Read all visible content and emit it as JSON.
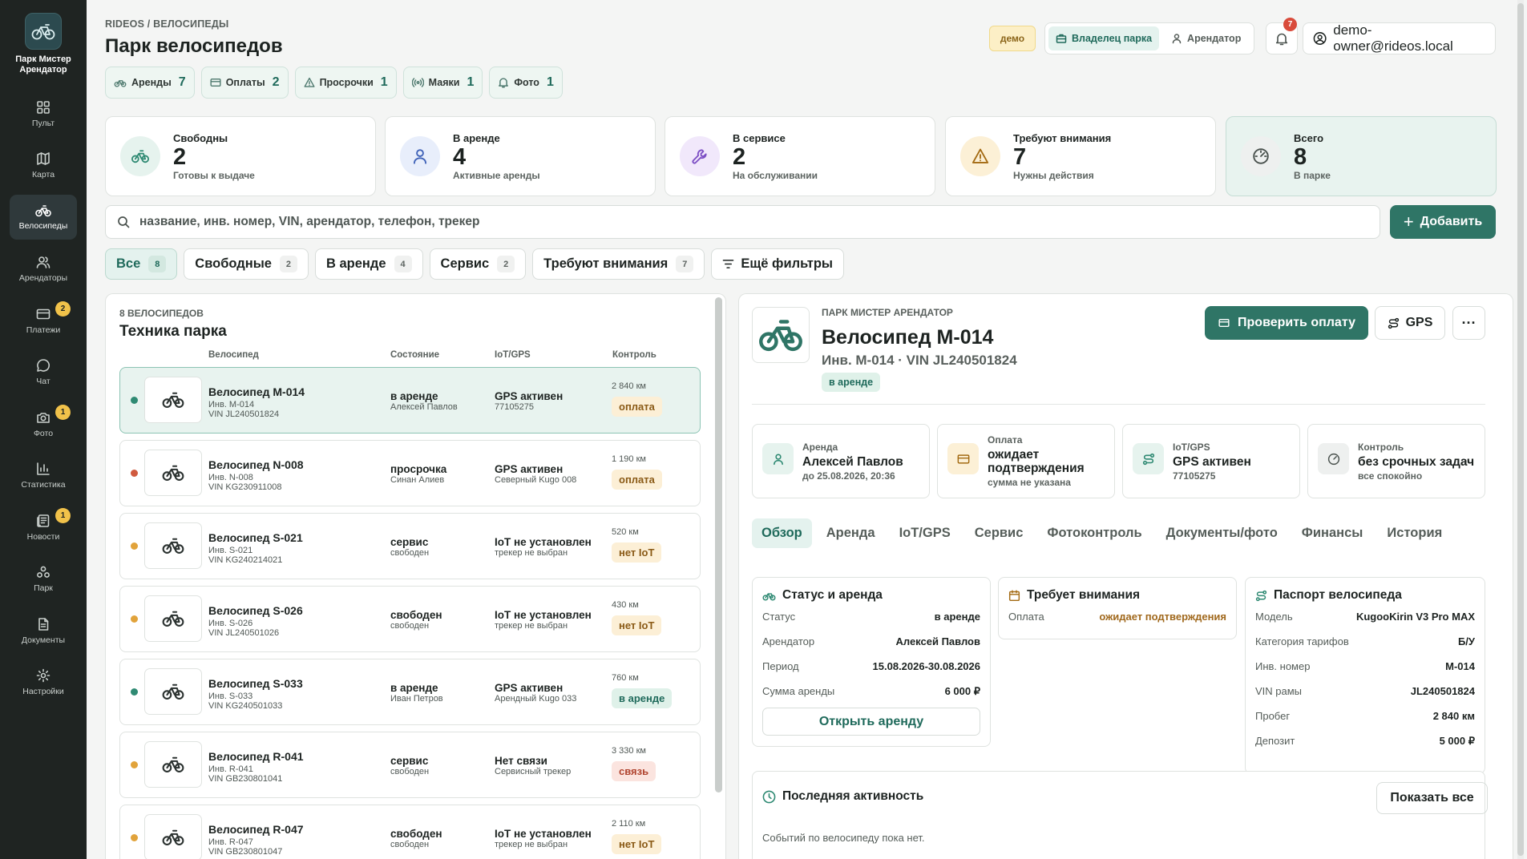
{
  "sidebar": {
    "brand": "Парк Мистер Арендатор",
    "items": [
      {
        "label": "Пульт",
        "icon": "dashboard-icon"
      },
      {
        "label": "Карта",
        "icon": "map-icon"
      },
      {
        "label": "Велосипеды",
        "icon": "bike-icon",
        "active": true
      },
      {
        "label": "Арендаторы",
        "icon": "users-icon"
      },
      {
        "label": "Платежи",
        "icon": "card-icon",
        "badge": "2"
      },
      {
        "label": "Чат",
        "icon": "chat-icon"
      },
      {
        "label": "Фото",
        "icon": "camera-icon",
        "badge": "1"
      },
      {
        "label": "Статистика",
        "icon": "stats-icon"
      },
      {
        "label": "Новости",
        "icon": "news-icon",
        "badge": "1"
      },
      {
        "label": "Парк",
        "icon": "park-icon"
      },
      {
        "label": "Документы",
        "icon": "document-icon"
      },
      {
        "label": "Настройки",
        "icon": "gear-icon"
      }
    ]
  },
  "header": {
    "breadcrumb": "RIDEOS / ВЕЛОСИПЕДЫ",
    "title": "Парк велосипедов",
    "demo": "демо",
    "role_owner": "Владелец парка",
    "role_renter": "Арендатор",
    "notifications": "7",
    "account": "demo-owner@rideos.local"
  },
  "chips": [
    {
      "label": "Аренды",
      "count": "7"
    },
    {
      "label": "Оплаты",
      "count": "2"
    },
    {
      "label": "Просрочки",
      "count": "1"
    },
    {
      "label": "Маяки",
      "count": "1"
    },
    {
      "label": "Фото",
      "count": "1"
    }
  ],
  "stats": [
    {
      "title": "Свободны",
      "value": "2",
      "sub": "Готовы к выдаче"
    },
    {
      "title": "В аренде",
      "value": "4",
      "sub": "Активные аренды"
    },
    {
      "title": "В сервисе",
      "value": "2",
      "sub": "На обслуживании"
    },
    {
      "title": "Требуют внимания",
      "value": "7",
      "sub": "Нужны действия"
    },
    {
      "title": "Всего",
      "value": "8",
      "sub": "В парке"
    }
  ],
  "search": {
    "placeholder": "название, инв. номер, VIN, арендатор, телефон, трекер"
  },
  "add_label": "Добавить",
  "filters": [
    {
      "label": "Все",
      "count": "8"
    },
    {
      "label": "Свободные",
      "count": "2"
    },
    {
      "label": "В аренде",
      "count": "4"
    },
    {
      "label": "Сервис",
      "count": "2"
    },
    {
      "label": "Требуют внимания",
      "count": "7"
    }
  ],
  "more_filters": "Ещё фильтры",
  "list": {
    "eyebrow": "8 ВЕЛОСИПЕДОВ",
    "title": "Техника парка",
    "columns": [
      "Велосипед",
      "Состояние",
      "IoT/GPS",
      "Контроль"
    ],
    "rows": [
      {
        "name": "Велосипед M-014",
        "inv": "Инв. M-014",
        "vin": "VIN JL240501824",
        "state": "в аренде",
        "state_sub": "Алексей Павлов",
        "iot": "GPS активен",
        "iot_sub": "77105275",
        "km": "2 840 км",
        "tag": "оплата"
      },
      {
        "name": "Велосипед N-008",
        "inv": "Инв. N-008",
        "vin": "VIN KG230911008",
        "state": "просрочка",
        "state_sub": "Синан Алиев",
        "iot": "GPS активен",
        "iot_sub": "Северный Kugo 008",
        "km": "1 190 км",
        "tag": "оплата"
      },
      {
        "name": "Велосипед S-021",
        "inv": "Инв. S-021",
        "vin": "VIN KG240214021",
        "state": "сервис",
        "state_sub": "свободен",
        "iot": "IoT не установлен",
        "iot_sub": "трекер не выбран",
        "km": "520 км",
        "tag": "нет IoT"
      },
      {
        "name": "Велосипед S-026",
        "inv": "Инв. S-026",
        "vin": "VIN JL240501026",
        "state": "свободен",
        "state_sub": "свободен",
        "iot": "IoT не установлен",
        "iot_sub": "трекер не выбран",
        "km": "430 км",
        "tag": "нет IoT"
      },
      {
        "name": "Велосипед S-033",
        "inv": "Инв. S-033",
        "vin": "VIN KG240501033",
        "state": "в аренде",
        "state_sub": "Иван Петров",
        "iot": "GPS активен",
        "iot_sub": "Арендный Kugo 033",
        "km": "760 км",
        "tag": "в аренде"
      },
      {
        "name": "Велосипед R-041",
        "inv": "Инв. R-041",
        "vin": "VIN GB230801041",
        "state": "сервис",
        "state_sub": "свободен",
        "iot": "Нет связи",
        "iot_sub": "Сервисный трекер",
        "km": "3 330 км",
        "tag": "связь"
      },
      {
        "name": "Велосипед R-047",
        "inv": "Инв. R-047",
        "vin": "VIN GB230801047",
        "state": "свободен",
        "state_sub": "свободен",
        "iot": "IoT не установлен",
        "iot_sub": "трекер не выбран",
        "km": "2 110 км",
        "tag": "нет IoT"
      }
    ]
  },
  "detail": {
    "eyebrow": "ПАРК МИСТЕР АРЕНДАТОР",
    "title": "Велосипед M-014",
    "subtitle": "Инв. M-014 · VIN JL240501824",
    "status": "в аренде",
    "pay_button": "Проверить оплату",
    "gps_button": "GPS",
    "more_button": "···",
    "info": [
      {
        "label": "Аренда",
        "value": "Алексей Павлов",
        "sub": "до 25.08.2026, 20:36"
      },
      {
        "label": "Оплата",
        "value": "ожидает подтверждения",
        "sub": "сумма не указана"
      },
      {
        "label": "IoT/GPS",
        "value": "GPS активен",
        "sub": "77105275"
      },
      {
        "label": "Контроль",
        "value": "без срочных задач",
        "sub": "все спокойно"
      }
    ],
    "tabs": [
      "Обзор",
      "Аренда",
      "IoT/GPS",
      "Сервис",
      "Фотоконтроль",
      "Документы/фото",
      "Финансы",
      "История"
    ],
    "status_box": {
      "title": "Статус и аренда",
      "rows": [
        {
          "k": "Статус",
          "v": "в аренде"
        },
        {
          "k": "Арендатор",
          "v": "Алексей Павлов"
        },
        {
          "k": "Период",
          "v": "15.08.2026-30.08.2026"
        },
        {
          "k": "Сумма аренды",
          "v": "6 000 ₽"
        }
      ],
      "open_button": "Открыть аренду"
    },
    "attention_box": {
      "title": "Требует внимания",
      "rows": [
        {
          "k": "Оплата",
          "v": "ожидает подтверждения"
        }
      ]
    },
    "passport_box": {
      "title": "Паспорт велосипеда",
      "rows": [
        {
          "k": "Модель",
          "v": "KugooKirin V3 Pro MAX"
        },
        {
          "k": "Категория тарифов",
          "v": "Б/У"
        },
        {
          "k": "Инв. номер",
          "v": "M-014"
        },
        {
          "k": "VIN рамы",
          "v": "JL240501824"
        },
        {
          "k": "Пробег",
          "v": "2 840 км"
        },
        {
          "k": "Депозит",
          "v": "5 000 ₽"
        }
      ]
    },
    "activity": {
      "title": "Последняя активность",
      "show_all": "Показать все",
      "empty": "Событий по велосипеду пока нет."
    }
  },
  "colors": {
    "accent": "#2f7566",
    "sidebar": "#1f2422",
    "green": "#2f8a73",
    "orange": "#e1a33b",
    "red": "#d05a3f"
  }
}
